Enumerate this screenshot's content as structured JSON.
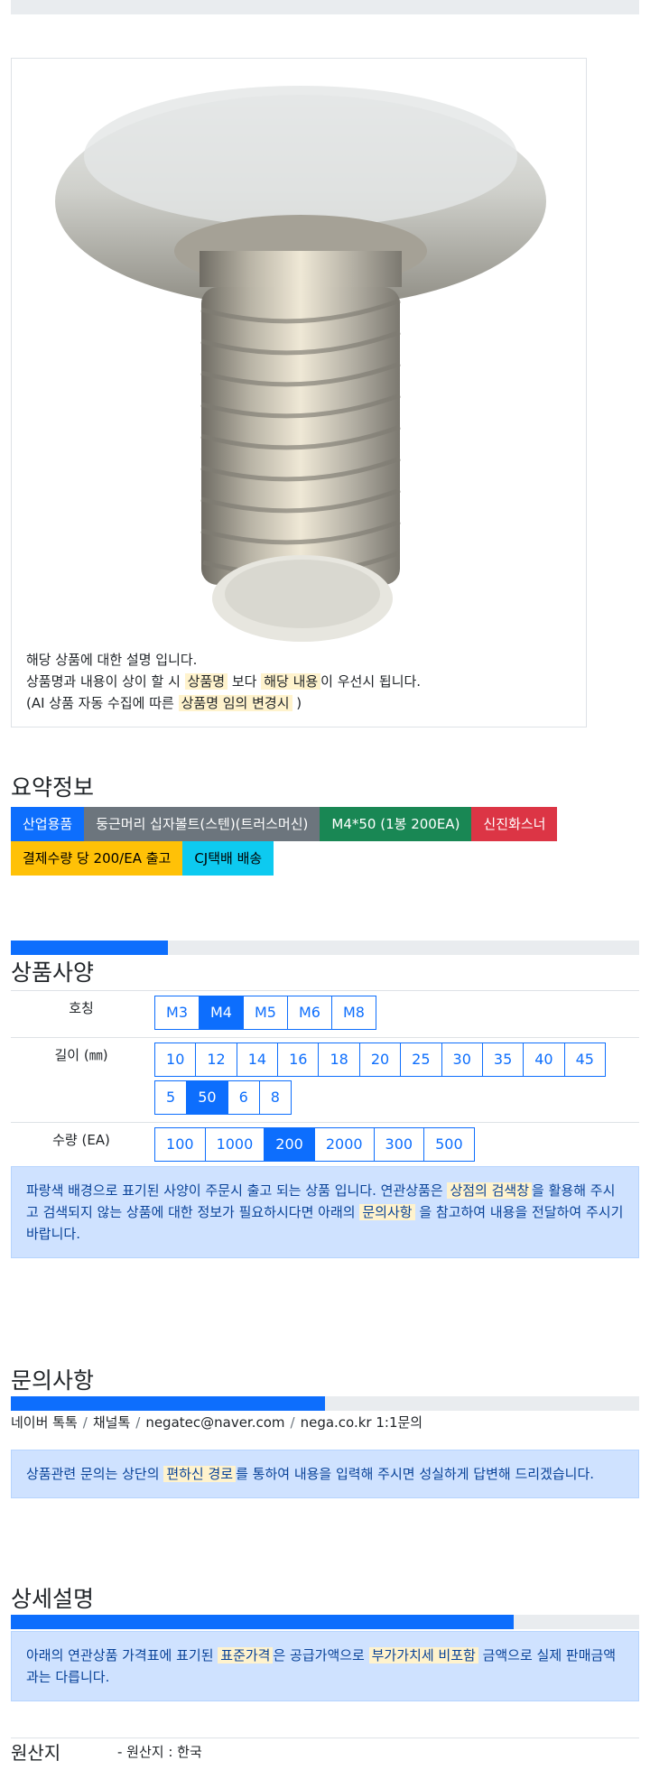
{
  "product_image": {
    "alt": "bolt-image"
  },
  "notice": {
    "line1": "해당 상품에 대한 설명 입니다.",
    "line2_a": "상품명과 내용이 상이 할 시 ",
    "line2_hl1": "상품명",
    "line2_b": " 보다 ",
    "line2_hl2": "해당 내용",
    "line2_c": "이 우선시 됩니다.",
    "line3_a": "(AI 상품 자동 수집에 따른 ",
    "line3_hl": "상품명 임의 변경시",
    "line3_b": " )"
  },
  "summary": {
    "title": "요약정보",
    "badges": [
      "산업용품",
      "둥근머리 십자볼트(스텐)(트러스머신)",
      "M4*50 (1봉 200EA)",
      "신진화스너",
      "결제수량 당 200/EA 출고",
      "CJ택배 배송"
    ]
  },
  "spec": {
    "progress_percent": 25,
    "title": "상품사양",
    "rows": [
      {
        "label": "호칭",
        "options": [
          "M3",
          "M4",
          "M5",
          "M6",
          "M8"
        ],
        "selected": "M4"
      },
      {
        "label": "길이 (㎜)",
        "options": [
          "10",
          "12",
          "14",
          "16",
          "18",
          "20",
          "25",
          "30",
          "35",
          "40",
          "45",
          "5",
          "50",
          "6",
          "8"
        ],
        "selected": "50"
      },
      {
        "label": "수량 (EA)",
        "options": [
          "100",
          "1000",
          "200",
          "2000",
          "300",
          "500"
        ],
        "selected": "200"
      }
    ],
    "alert_a": "파랑색 배경으로 표기된 사양이 주문시 출고 되는 상품 입니다. 연관상품은 ",
    "alert_hl1": "상점의 검색창",
    "alert_b": "을 활용해 주시고 검색되지 않는 상품에 대한 정보가 필요하시다면 아래의 ",
    "alert_hl2": "문의사항",
    "alert_c": " 을 참고하여 내용을 전달하여 주시기 바랍니다."
  },
  "inquiry": {
    "title": "문의사항",
    "progress_percent": 50,
    "contacts": [
      "네이버 톡톡",
      "채널톡",
      "negatec@naver.com",
      "nega.co.kr 1:1문의"
    ],
    "separator": "/",
    "alert_a": "상품관련 문의는 상단의 ",
    "alert_hl": "편하신 경로",
    "alert_b": "를 통하여 내용을 입력해 주시면 성실하게 답변해 드리겠습니다."
  },
  "detail": {
    "title": "상세설명",
    "progress_percent": 80,
    "alert_a": "아래의 연관상품 가격표에 표기된 ",
    "alert_hl1": "표준가격",
    "alert_b": "은 공급가액으로 ",
    "alert_hl2": "부가가치세 비포함",
    "alert_c": " 금액으로 실제 판매금액과는 다릅니다."
  },
  "origin": {
    "label": "원산지",
    "value": "- 원산지 : 한국"
  },
  "colors": {
    "primary": "#0d6efd",
    "alert_bg": "#cfe2ff",
    "highlight": "#fff3cd"
  }
}
